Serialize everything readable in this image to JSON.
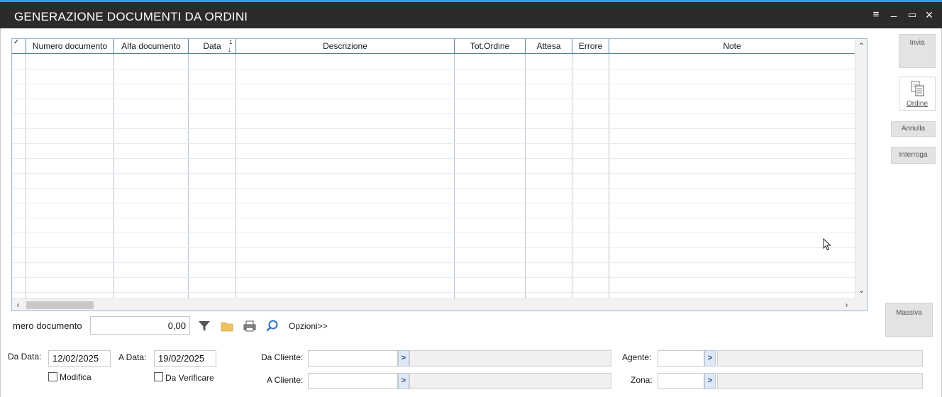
{
  "window": {
    "title": "GENERAZIONE DOCUMENTI DA ORDINI"
  },
  "window_controls": {
    "menu": "≡",
    "minimize": "_",
    "maximize": "▭",
    "close": "×"
  },
  "grid": {
    "select_all": "✓",
    "columns": [
      {
        "key": "numero_documento",
        "label": "Numero documento"
      },
      {
        "key": "alfa_documento",
        "label": "Alfa documento"
      },
      {
        "key": "data",
        "label": "Data",
        "sort_order": "1"
      },
      {
        "key": "descrizione",
        "label": "Descrizione"
      },
      {
        "key": "tot_ordine",
        "label": "Tot.Ordine"
      },
      {
        "key": "attesa",
        "label": "Attesa"
      },
      {
        "key": "errore",
        "label": "Errore"
      },
      {
        "key": "note",
        "label": "Note"
      }
    ],
    "rows": []
  },
  "side_buttons": {
    "invia": "Invia",
    "ordine": "Ordine",
    "annulla": "Annulla",
    "interroga": "Interroga",
    "massiva": "Massiva"
  },
  "toolbar": {
    "search_label": "mero documento",
    "search_value": "0,00",
    "options_label": "Opzioni>>"
  },
  "filters": {
    "da_data_label": "Da Data:",
    "da_data_value": "12/02/2025",
    "a_data_label": "A Data:",
    "a_data_value": "19/02/2025",
    "modifica_label": "Modifica",
    "modifica_checked": false,
    "da_verificare_label": "Da Verificare",
    "da_verificare_checked": false,
    "da_cliente_label": "Da Cliente:",
    "da_cliente_value": "",
    "a_cliente_label": "A Cliente:",
    "a_cliente_value": "",
    "agente_label": "Agente:",
    "agente_value": "",
    "zona_label": "Zona:",
    "zona_value": "",
    "lookup_glyph": ">"
  },
  "colors": {
    "titlebar": "#2b2b2b",
    "accent": "#2fa4d9",
    "grid_border": "#5a7fa6",
    "filter_icon": "#555555",
    "folder_icon": "#f0c060",
    "search_icon": "#2a73c9"
  },
  "icons": {
    "filter": "filter-icon",
    "folder": "folder-icon",
    "print": "print-icon",
    "search": "search-icon",
    "copy": "copy-documents-icon"
  }
}
